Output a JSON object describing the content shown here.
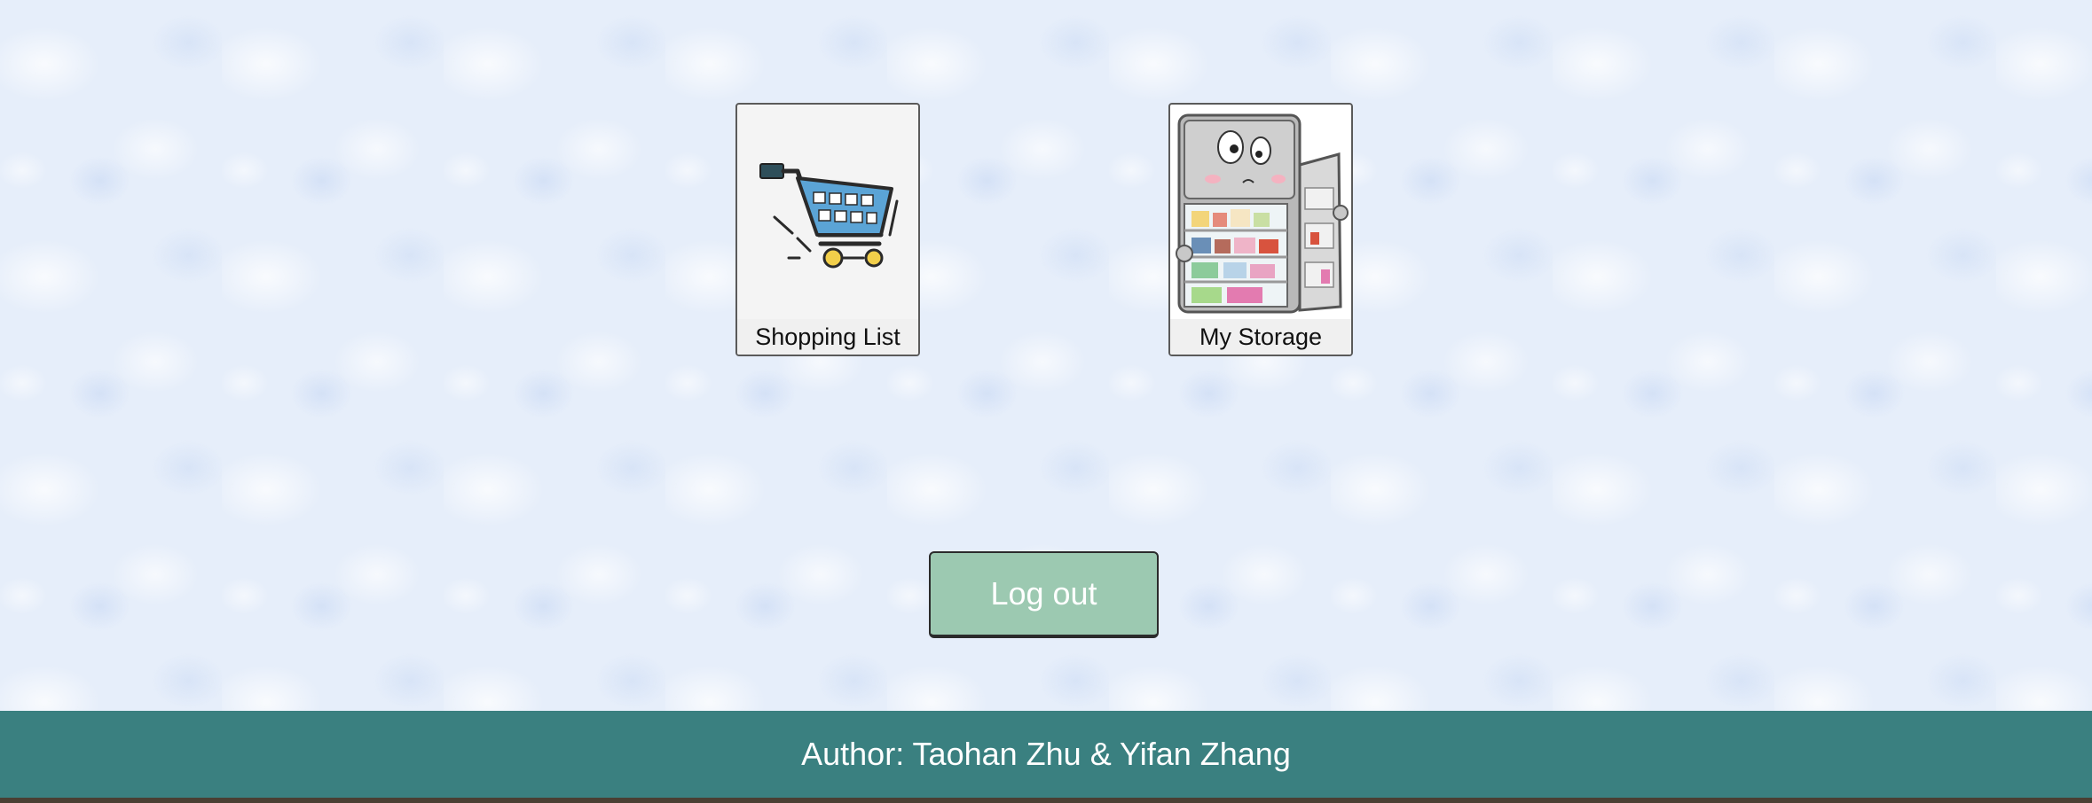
{
  "tiles": [
    {
      "label": "Shopping List",
      "icon": "shopping-cart-icon"
    },
    {
      "label": "My Storage",
      "icon": "refrigerator-icon"
    }
  ],
  "logout_label": "Log out",
  "footer_text": "Author: Taohan Zhu & Yifan Zhang",
  "colors": {
    "background": "#e6eefa",
    "logout_button": "#9cc9b1",
    "footer": "#3a8080",
    "cart_blue": "#5ba4d6",
    "cart_wheel": "#f2cf4a"
  }
}
